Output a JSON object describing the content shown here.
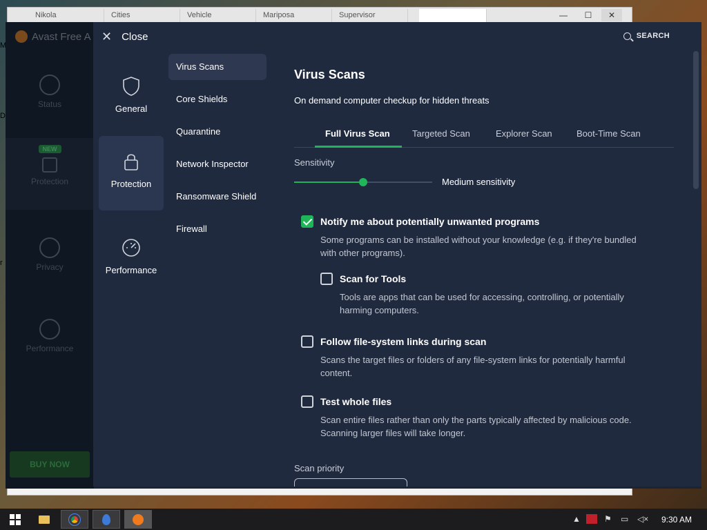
{
  "background_browser": {
    "tabs": [
      "Nikola",
      "Cities",
      "Vehicle",
      "Mariposa",
      "Supervisor",
      ""
    ],
    "controls": {
      "min": "—",
      "max": "☐",
      "close": "✕"
    },
    "edge_marks": [
      "M",
      "D",
      "r"
    ]
  },
  "avast_app": {
    "title": "Avast Free A",
    "nav": [
      {
        "label": "Status"
      },
      {
        "label": "Protection",
        "badge": "NEW"
      },
      {
        "label": "Privacy"
      },
      {
        "label": "Performance"
      }
    ],
    "buy_now": "BUY NOW"
  },
  "settings": {
    "close_label": "Close",
    "search_label": "SEARCH",
    "categories": [
      {
        "label": "General",
        "icon": "shield-icon"
      },
      {
        "label": "Protection",
        "icon": "lock-icon"
      },
      {
        "label": "Performance",
        "icon": "speedometer-icon"
      }
    ],
    "subnav": [
      "Virus Scans",
      "Core Shields",
      "Quarantine",
      "Network Inspector",
      "Ransomware Shield",
      "Firewall"
    ],
    "page_title": "Virus Scans",
    "page_subtitle": "On demand computer checkup for hidden threats",
    "tabs": [
      "Full Virus Scan",
      "Targeted Scan",
      "Explorer Scan",
      "Boot-Time Scan"
    ],
    "sensitivity": {
      "label": "Sensitivity",
      "value_text": "Medium sensitivity",
      "level": 0.5
    },
    "options": [
      {
        "title": "Notify me about potentially unwanted programs",
        "desc_1": "Some programs can be installed without your knowledge (e.g. if they're bundled",
        "desc_2": "with other programs).",
        "checked": true
      },
      {
        "title": "Scan for Tools",
        "desc_1": "Tools are apps that can be used for accessing, controlling, or potentially",
        "desc_2": "harming computers.",
        "checked": false
      },
      {
        "title": "Follow file-system links during scan",
        "desc_1": "Scans the target files or folders of any file-system links for potentially harmful",
        "desc_2": "content.",
        "checked": false
      },
      {
        "title": "Test whole files",
        "desc_1": "Scan entire files rather than only the parts typically affected by malicious code.",
        "desc_2": "Scanning larger files will take longer.",
        "checked": false
      }
    ],
    "scan_priority_label": "Scan priority"
  },
  "taskbar": {
    "clock": "9:30 AM"
  },
  "colors": {
    "accent_green": "#21b559",
    "panel_bg": "#202a3f"
  }
}
